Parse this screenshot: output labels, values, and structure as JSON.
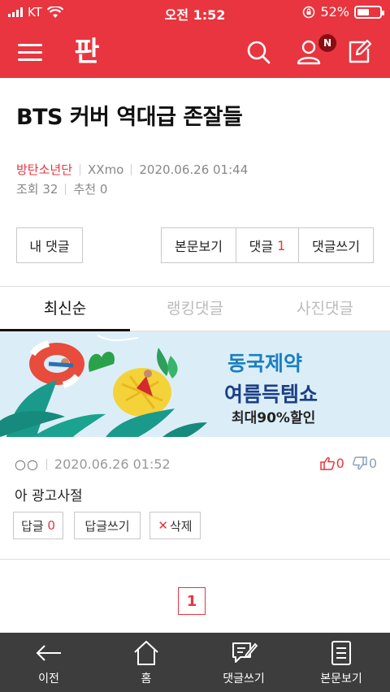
{
  "status": {
    "carrier": "KT",
    "time": "오전 1:52",
    "battery": "52%",
    "battery_level": 0.52
  },
  "header": {
    "logo": "판",
    "notification_badge": "N"
  },
  "article": {
    "title": "BTS 커버 역대급 존잘들",
    "category": "방탄소년단",
    "author": "XXmo",
    "date": "2020.06.26 01:44",
    "views": "조회 32",
    "recommends": "추천 0"
  },
  "actions": {
    "my_comments": "내 댓글",
    "view_post": "본문보기",
    "comments_label": "댓글",
    "comments_count": "1",
    "write_comment": "댓글쓰기"
  },
  "tabs": [
    {
      "label": "최신순"
    },
    {
      "label": "랭킹댓글"
    },
    {
      "label": "사진댓글"
    }
  ],
  "banner": {
    "line1": "동국제약",
    "line2": "여름득템쇼",
    "line3": "최대90%할인"
  },
  "comment": {
    "nickname": "○○",
    "date": "2020.06.26 01:52",
    "likes": "0",
    "dislikes": "0",
    "text": "아 광고사절",
    "reply_label": "답글",
    "reply_count": "0",
    "write_reply": "답글쓰기",
    "delete_label": "삭제",
    "delete_mark": "✕"
  },
  "pagination": {
    "current": "1"
  },
  "bottom_nav": [
    {
      "label": "이전",
      "icon": "back-arrow-icon"
    },
    {
      "label": "홈",
      "icon": "home-icon"
    },
    {
      "label": "댓글쓰기",
      "icon": "comment-write-icon"
    },
    {
      "label": "본문보기",
      "icon": "document-icon"
    }
  ],
  "colors": {
    "brand": "#e8353f",
    "bottom_bar": "#3d3d3d"
  }
}
